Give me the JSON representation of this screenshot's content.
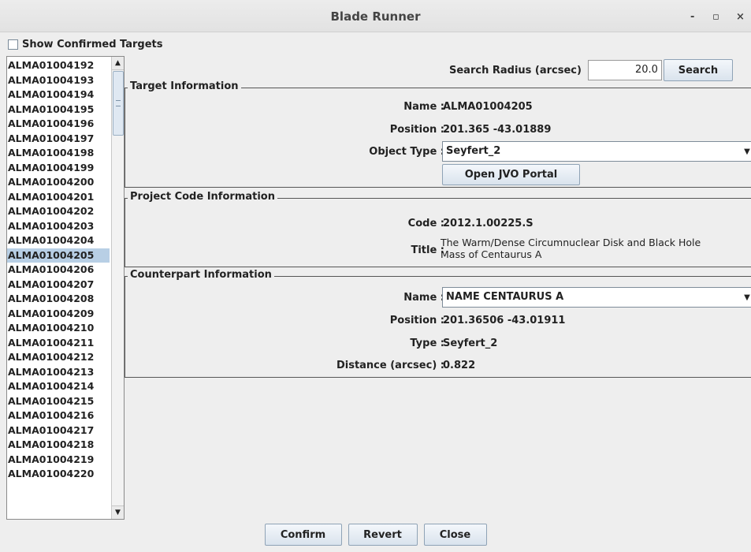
{
  "window": {
    "title": "Blade Runner",
    "minimize_label": "-",
    "maximize_label": "▫",
    "close_label": "×"
  },
  "show_confirmed": {
    "label": "Show Confirmed Targets",
    "checked": false
  },
  "target_list": {
    "items": [
      "ALMA01004192",
      "ALMA01004193",
      "ALMA01004194",
      "ALMA01004195",
      "ALMA01004196",
      "ALMA01004197",
      "ALMA01004198",
      "ALMA01004199",
      "ALMA01004200",
      "ALMA01004201",
      "ALMA01004202",
      "ALMA01004203",
      "ALMA01004204",
      "ALMA01004205",
      "ALMA01004206",
      "ALMA01004207",
      "ALMA01004208",
      "ALMA01004209",
      "ALMA01004210",
      "ALMA01004211",
      "ALMA01004212",
      "ALMA01004213",
      "ALMA01004214",
      "ALMA01004215",
      "ALMA01004216",
      "ALMA01004217",
      "ALMA01004218",
      "ALMA01004219",
      "ALMA01004220"
    ],
    "selected": "ALMA01004205",
    "scroll_up_icon": "▲",
    "scroll_down_icon": "▼"
  },
  "search": {
    "radius_label": "Search Radius (arcsec)",
    "radius_value": "20.0",
    "button_label": "Search"
  },
  "target_info": {
    "title": "Target Information",
    "name_label": "Name :",
    "name_value": "ALMA01004205",
    "position_label": "Position :",
    "position_value": "201.365 -43.01889",
    "object_type_label": "Object Type :",
    "object_type_value": "Seyfert_2",
    "open_jvo_label": "Open JVO Portal"
  },
  "project_info": {
    "title": "Project Code Information",
    "code_label": "Code :",
    "code_value": "2012.1.00225.S",
    "title_label": "Title :",
    "title_value_line1": "The Warm/Dense Circumnuclear Disk and Black Hole",
    "title_value_line2": "Mass of Centaurus A"
  },
  "counterpart_info": {
    "title": "Counterpart Information",
    "name_label": "Name :",
    "name_value": "NAME CENTAURUS A",
    "position_label": "Position :",
    "position_value": "201.36506 -43.01911",
    "type_label": "Type :",
    "type_value": "Seyfert_2",
    "distance_label": "Distance (arcsec) :",
    "distance_value": "0.822"
  },
  "actions": {
    "confirm_label": "Confirm",
    "revert_label": "Revert",
    "close_label": "Close"
  },
  "icons": {
    "dropdown": "▼"
  },
  "colors": {
    "selection": "#b8cfe5",
    "button_border": "#8fa3b6",
    "background": "#eeeeee"
  }
}
